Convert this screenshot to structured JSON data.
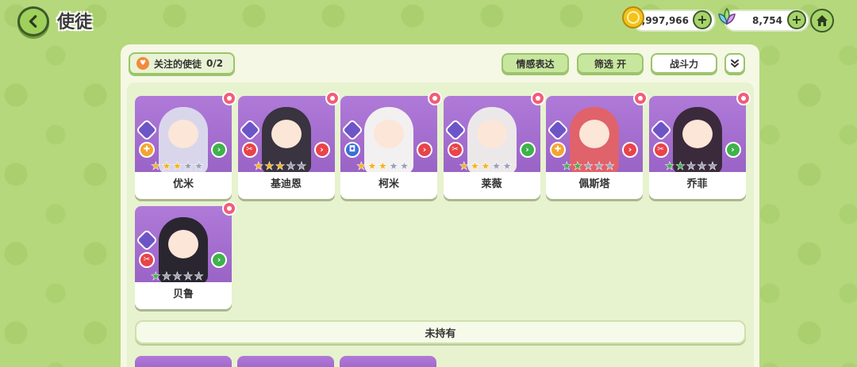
{
  "header": {
    "title": "使徒",
    "gold": "2,997,966",
    "gems": "8,754"
  },
  "toolbar": {
    "follow_label": "关注的使徒",
    "follow_count": "0/2",
    "emote_label": "情感表达",
    "filter_label": "筛选 开",
    "power_label": "战斗力"
  },
  "characters": [
    {
      "name": "优米",
      "stars_filled": 3,
      "star_color": "gold",
      "role": "heal",
      "arrow": "green",
      "hair": "#d9d6ec"
    },
    {
      "name": "基迪恩",
      "stars_filled": 3,
      "star_color": "gold",
      "role": "atk",
      "arrow": "red",
      "hair": "#3a3340"
    },
    {
      "name": "柯米",
      "stars_filled": 3,
      "star_color": "gold",
      "role": "def",
      "arrow": "red",
      "hair": "#f2f0f0"
    },
    {
      "name": "莱薇",
      "stars_filled": 3,
      "star_color": "gold",
      "role": "atk",
      "arrow": "green",
      "hair": "#ece8ea"
    },
    {
      "name": "佩斯塔",
      "stars_filled": 2,
      "star_color": "green",
      "role": "heal",
      "arrow": "red",
      "hair": "#e0626a"
    },
    {
      "name": "乔菲",
      "stars_filled": 2,
      "star_color": "green",
      "role": "atk",
      "arrow": "green",
      "hair": "#3b2a3c"
    },
    {
      "name": "贝鲁",
      "stars_filled": 1,
      "star_color": "green",
      "role": "atk",
      "arrow": "green",
      "hair": "#2a2630"
    }
  ],
  "unowned_label": "未持有"
}
